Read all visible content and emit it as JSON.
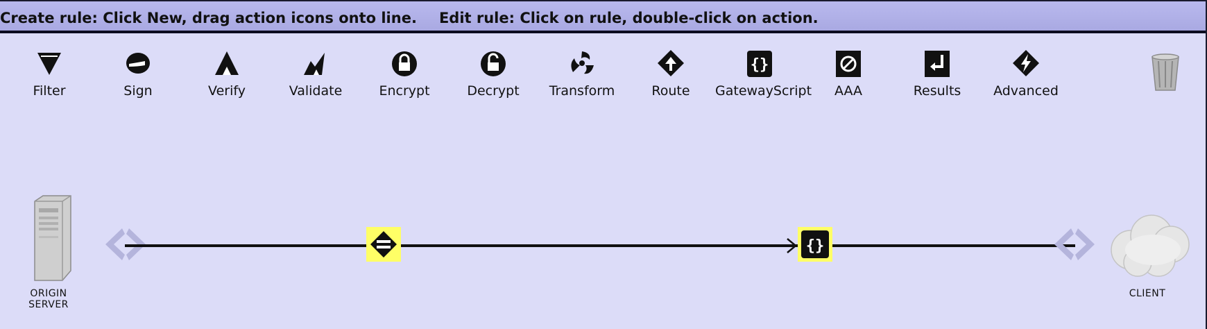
{
  "instructions": {
    "create": "Create rule: Click New, drag action icons onto line.",
    "edit": "Edit rule: Click on rule, double-click on action."
  },
  "palette": [
    {
      "label": "Filter",
      "icon": "filter-icon"
    },
    {
      "label": "Sign",
      "icon": "sign-icon"
    },
    {
      "label": "Verify",
      "icon": "verify-icon"
    },
    {
      "label": "Validate",
      "icon": "validate-icon"
    },
    {
      "label": "Encrypt",
      "icon": "encrypt-icon"
    },
    {
      "label": "Decrypt",
      "icon": "decrypt-icon"
    },
    {
      "label": "Transform",
      "icon": "transform-icon"
    },
    {
      "label": "Route",
      "icon": "route-icon"
    },
    {
      "label": "GatewayScript",
      "icon": "gatewayscript-icon"
    },
    {
      "label": "AAA",
      "icon": "aaa-icon"
    },
    {
      "label": "Results",
      "icon": "results-icon"
    },
    {
      "label": "Advanced",
      "icon": "advanced-icon"
    }
  ],
  "canvas": {
    "server_label_line1": "ORIGIN",
    "server_label_line2": "SERVER",
    "client_label": "CLIENT",
    "actions": [
      {
        "type": "match-icon"
      },
      {
        "type": "gatewayscript-icon"
      }
    ]
  },
  "colors": {
    "background": "#dcdcf8",
    "header": "#b0b0e8",
    "selection": "#ffff66",
    "chevron": "#b4b4dc"
  }
}
